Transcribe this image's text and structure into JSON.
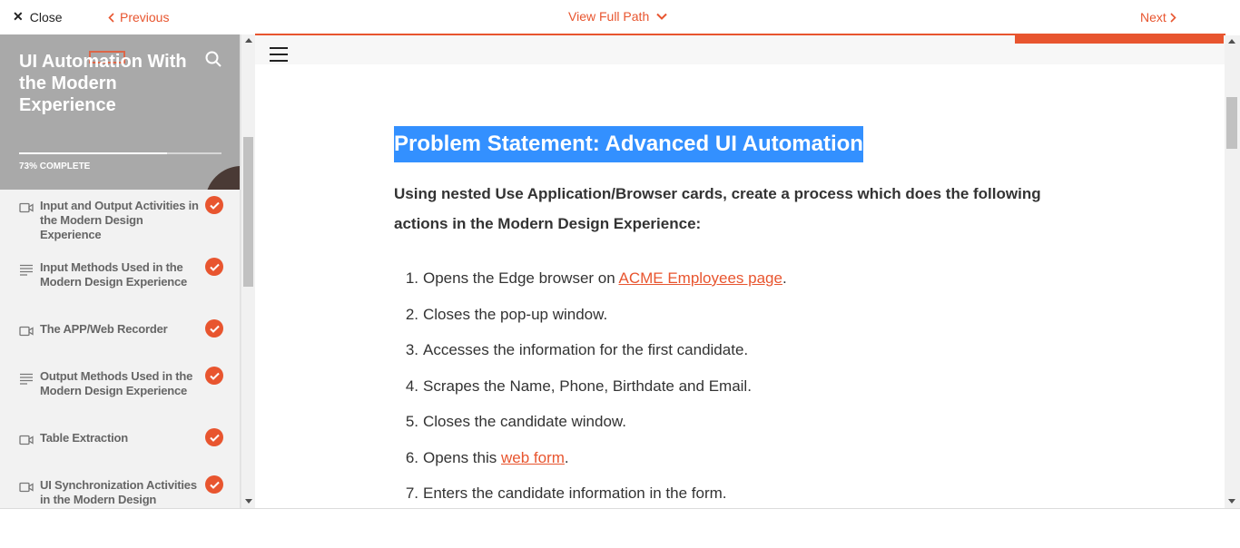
{
  "topbar": {
    "close_label": "Close",
    "previous_label": "Previous",
    "view_path_label": "View Full Path",
    "next_label": "Next"
  },
  "sidebar": {
    "course_title": "UI Automation With the Modern Experience",
    "progress_percent": 73,
    "progress_label": "73% COMPLETE",
    "lessons": [
      {
        "icon": "video-icon",
        "label": "Input and Output Activities in the Modern Design Experience",
        "completed": true
      },
      {
        "icon": "text-lines-icon",
        "label": "Input Methods Used in the Modern Design Experience",
        "completed": true
      },
      {
        "icon": "video-icon",
        "label": "The APP/Web Recorder",
        "completed": true
      },
      {
        "icon": "text-lines-icon",
        "label": "Output Methods Used in the Modern Design Experience",
        "completed": true
      },
      {
        "icon": "video-icon",
        "label": "Table Extraction",
        "completed": true
      },
      {
        "icon": "video-icon",
        "label": "UI Synchronization Activities in the Modern Design",
        "completed": true
      }
    ]
  },
  "main": {
    "heading": "Problem Statement: Advanced UI Automation",
    "intro": "Using nested Use Application/Browser cards, create a process which does the following actions in the Modern Design Experience:",
    "steps": [
      {
        "num": "1.",
        "before": "Opens the Edge browser on ",
        "link": "ACME Employees page",
        "after": "."
      },
      {
        "num": "2.",
        "before": "Closes the pop-up window.",
        "link": "",
        "after": ""
      },
      {
        "num": "3.",
        "before": "Accesses the information for the first candidate.",
        "link": "",
        "after": ""
      },
      {
        "num": "4.",
        "before": "Scrapes the Name, Phone, Birthdate and Email.",
        "link": "",
        "after": ""
      },
      {
        "num": "5.",
        "before": "Closes the candidate window.",
        "link": "",
        "after": ""
      },
      {
        "num": "6.",
        "before": "Opens this ",
        "link": "web form",
        "after": "."
      },
      {
        "num": "7.",
        "before": "Enters the candidate information in the form.",
        "link": "",
        "after": ""
      }
    ]
  },
  "colors": {
    "accent": "#e8552f",
    "heading_highlight": "#3390ff",
    "sidebar_hero": "#a9a9a9"
  }
}
